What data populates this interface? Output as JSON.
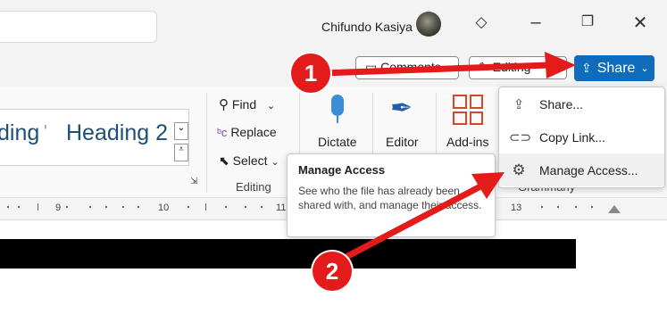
{
  "window": {
    "user_name": "Chifundo Kasiya"
  },
  "command_bar": {
    "comments_label": "Comments",
    "editing_label": "Editing",
    "share_label": "Share"
  },
  "ribbon": {
    "style_partial": "ding",
    "style_heading2": "Heading 2",
    "find_label": "Find",
    "replace_label": "Replace",
    "select_label": "Select",
    "editing_group": "Editing",
    "dictate_label": "Dictate",
    "editor_label": "Editor",
    "addins_label": "Add-ins",
    "grammarly_group": "Grammarly"
  },
  "ruler": {
    "marks": [
      "9",
      "10",
      "11",
      "13"
    ]
  },
  "share_menu": {
    "items": [
      {
        "label": "Share...",
        "icon": "share-icon"
      },
      {
        "label": "Copy Link...",
        "icon": "link-icon"
      },
      {
        "label": "Manage Access...",
        "icon": "gear-icon"
      }
    ]
  },
  "tooltip": {
    "title": "Manage Access",
    "body": "See who the file has already been shared with, and manage their access."
  },
  "annotations": {
    "step1": "1",
    "step2": "2",
    "arrow_color": "#e31b1b"
  }
}
